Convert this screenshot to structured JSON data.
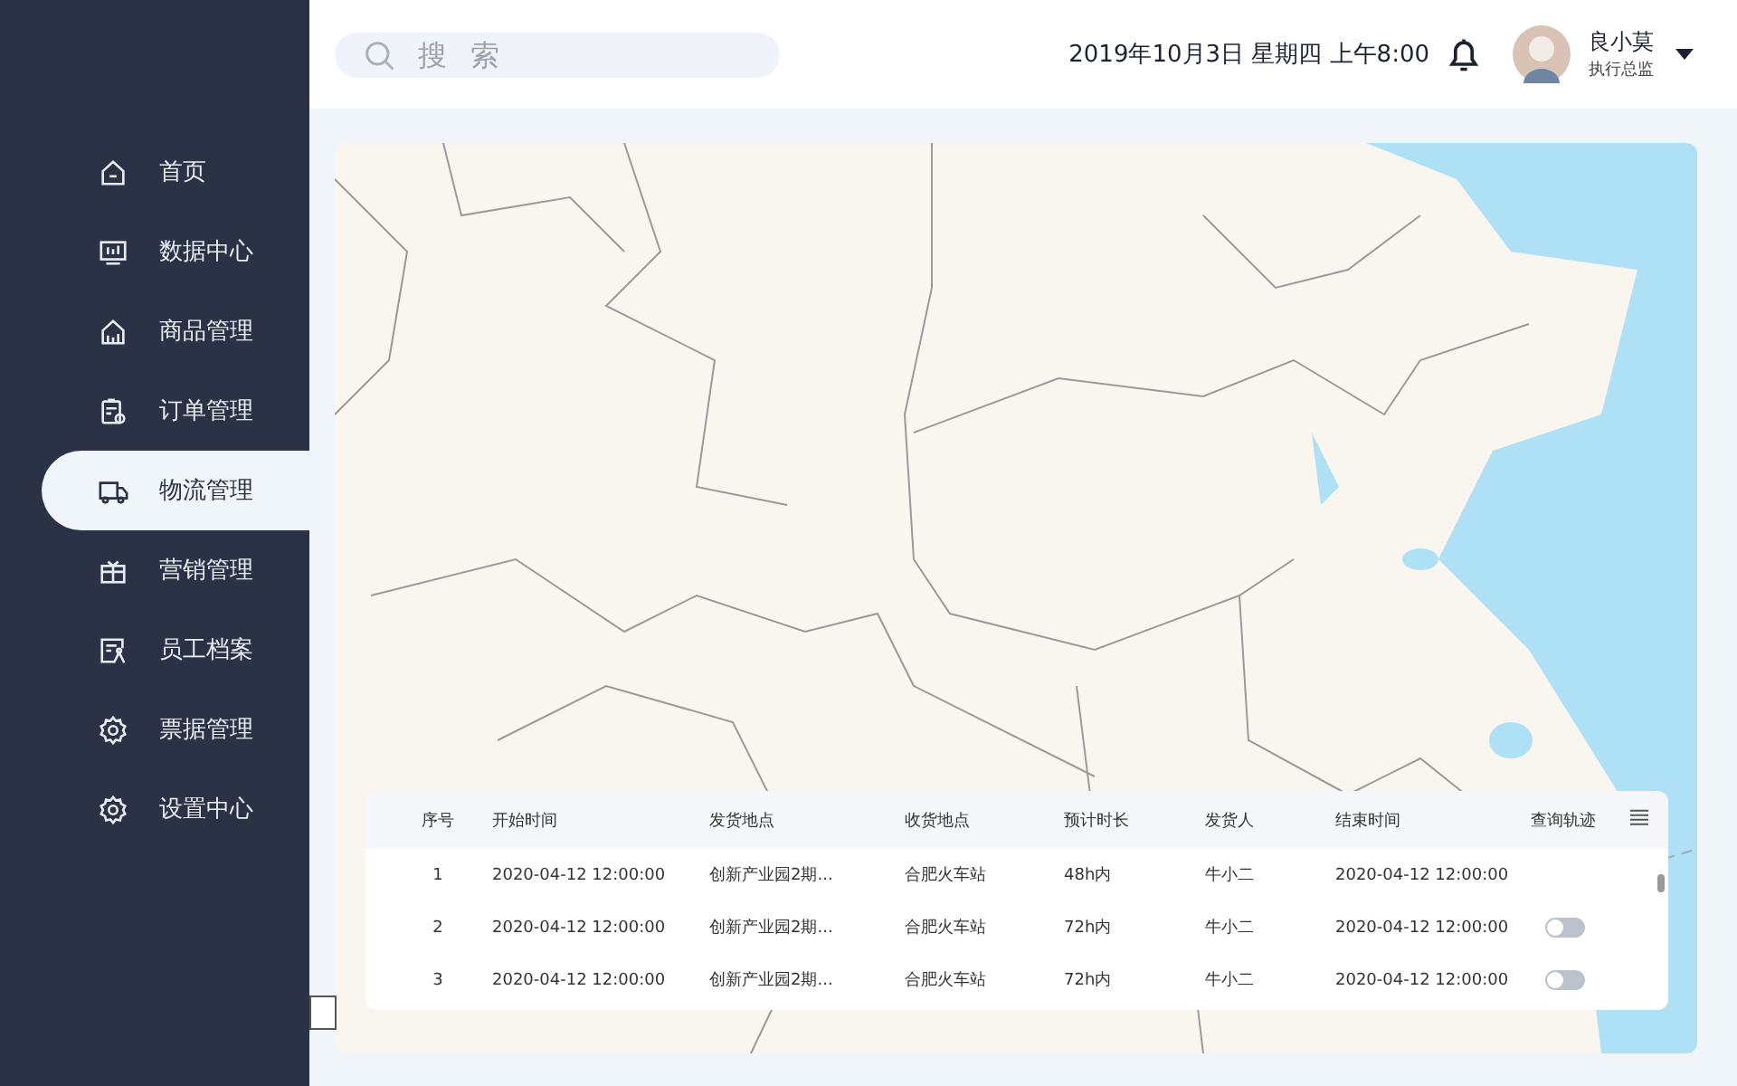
{
  "sidebar": {
    "items": [
      {
        "label": "首页",
        "kind": "home",
        "selected": false
      },
      {
        "label": "数据中心",
        "kind": "monitor",
        "selected": false
      },
      {
        "label": "商品管理",
        "kind": "store",
        "selected": false
      },
      {
        "label": "订单管理",
        "kind": "clipboard",
        "selected": false
      },
      {
        "label": "物流管理",
        "kind": "truck",
        "selected": true
      },
      {
        "label": "营销管理",
        "kind": "gift",
        "selected": false
      },
      {
        "label": "员工档案",
        "kind": "person",
        "selected": false
      },
      {
        "label": "票据管理",
        "kind": "gear",
        "selected": false
      },
      {
        "label": "设置中心",
        "kind": "gear",
        "selected": false
      }
    ]
  },
  "search": {
    "placeholder": "搜 索"
  },
  "header": {
    "datetime": "2019年10月3日 星期四 上午8:00",
    "user": {
      "name": "良小莫",
      "role": "执行总监"
    }
  },
  "table": {
    "columns": [
      "序号",
      "开始时间",
      "发货地点",
      "收货地点",
      "预计时长",
      "发货人",
      "结束时间",
      "查询轨迹"
    ],
    "rows": [
      {
        "cells": [
          "1",
          "2020-04-12 12:00:00",
          "创新产业园2期...",
          "合肥火车站",
          "48h内",
          "牛小二",
          "2020-04-12 12:00:00"
        ]
      },
      {
        "cells": [
          "2",
          "2020-04-12 12:00:00",
          "创新产业园2期...",
          "合肥火车站",
          "72h内",
          "牛小二",
          "2020-04-12 12:00:00"
        ],
        "tracking": false
      },
      {
        "cells": [
          "3",
          "2020-04-12 12:00:00",
          "创新产业园2期...",
          "合肥火车站",
          "72h内",
          "牛小二",
          "2020-04-12 12:00:00"
        ],
        "tracking": false
      }
    ]
  }
}
